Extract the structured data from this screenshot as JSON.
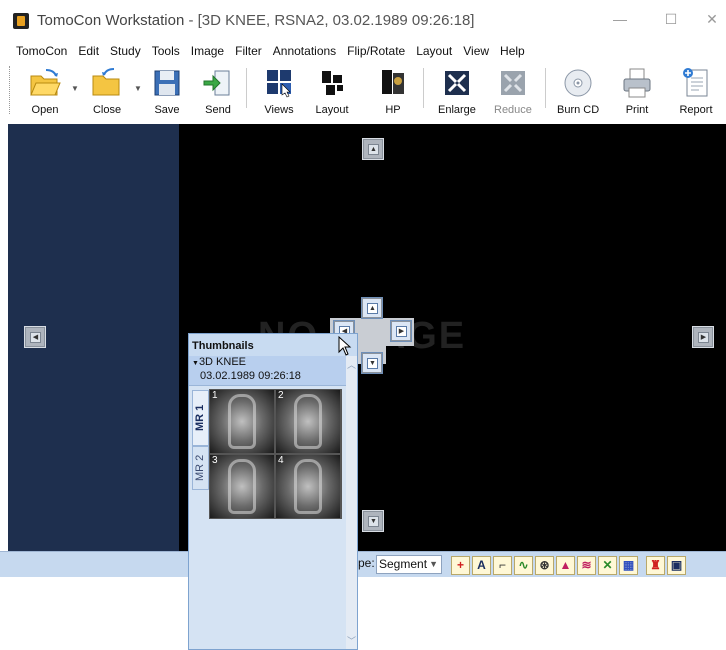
{
  "window": {
    "title_app": "TomoCon Workstation",
    "title_doc": "- [3D KNEE, RSNA2, 03.02.1989 09:26:18]",
    "minimize": "—",
    "maximize": "☐",
    "close": "✕"
  },
  "menu": [
    "TomoCon",
    "Edit",
    "Study",
    "Tools",
    "Image",
    "Filter",
    "Annotations",
    "Flip/Rotate",
    "Layout",
    "View",
    "Help"
  ],
  "toolbar": {
    "open": "Open",
    "close": "Close",
    "save": "Save",
    "send": "Send",
    "views": "Views",
    "layout": "Layout",
    "hp": "HP",
    "enlarge": "Enlarge",
    "reduce": "Reduce",
    "burn_cd": "Burn CD",
    "print": "Print",
    "report": "Report"
  },
  "viewport": {
    "placeholder": "NO IMAGE"
  },
  "status": {
    "type_label": "pe:",
    "type_value": "Segment"
  },
  "thumbnails": {
    "header": "Thumbnails",
    "study_name": "3D KNEE",
    "study_date": "03.02.1989 09:26:18",
    "tabs": [
      "MR 1",
      "MR 2"
    ],
    "images": [
      "1",
      "2",
      "3",
      "4"
    ]
  },
  "colors": {
    "left_panel": "#1e2f4e",
    "viewport": "#000000",
    "statusbar": "#c6d9ef",
    "panel": "#d5e3f3"
  }
}
